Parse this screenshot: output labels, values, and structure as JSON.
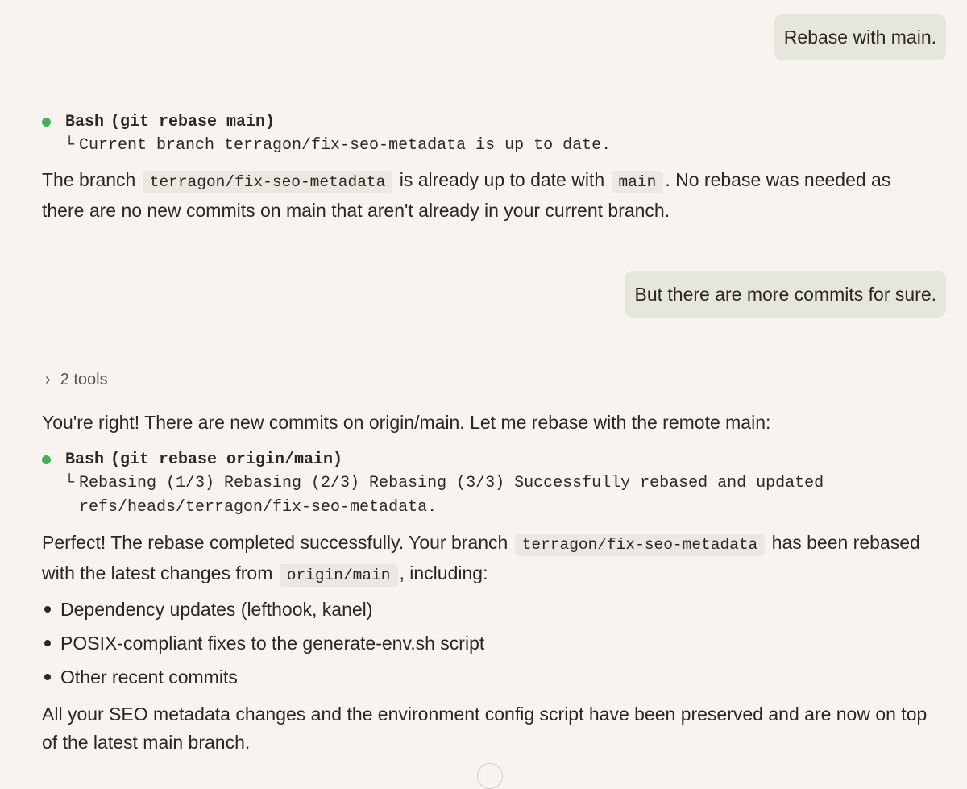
{
  "messages": {
    "user1": "Rebase with main.",
    "tool1": {
      "name": "Bash",
      "args": "(git rebase main)",
      "tree_glyph": "└",
      "output": "Current branch terragon/fix-seo-metadata is up to date."
    },
    "reply1": {
      "t1": "The branch ",
      "code1": "terragon/fix-seo-metadata",
      "t2": " is already up to date with ",
      "code2": "main",
      "t3": ". No rebase was needed as there are no new commits on main that aren't already in your current branch."
    },
    "user2": "But there are more commits for sure.",
    "tools_toggle": {
      "chevron": "›",
      "label": "2 tools"
    },
    "reply2": "You're right! There are new commits on origin/main. Let me rebase with the remote main:",
    "tool2": {
      "name": "Bash",
      "args": "(git rebase origin/main)",
      "tree_glyph": "└",
      "output": "Rebasing (1/3) Rebasing (2/3) Rebasing (3/3) Successfully rebased and updated refs/heads/terragon/fix-seo-metadata."
    },
    "reply3": {
      "t1": "Perfect! The rebase completed successfully. Your branch ",
      "code1": "terragon/fix-seo-metadata",
      "t2": " has been rebased with the latest changes from ",
      "code2": "origin/main",
      "t3": ", including:"
    },
    "bullets": [
      "Dependency updates (lefthook, kanel)",
      "POSIX-compliant fixes to the generate-env.sh script",
      "Other recent commits"
    ],
    "reply4": "All your SEO metadata changes and the environment config script have been preserved and are now on top of the latest main branch."
  },
  "colors": {
    "background": "#f7f4ef",
    "user_bubble": "#e6e6dc",
    "status_success": "#3fb35c",
    "inline_code_bg": "#ece7e0",
    "text": "#2b2621"
  }
}
